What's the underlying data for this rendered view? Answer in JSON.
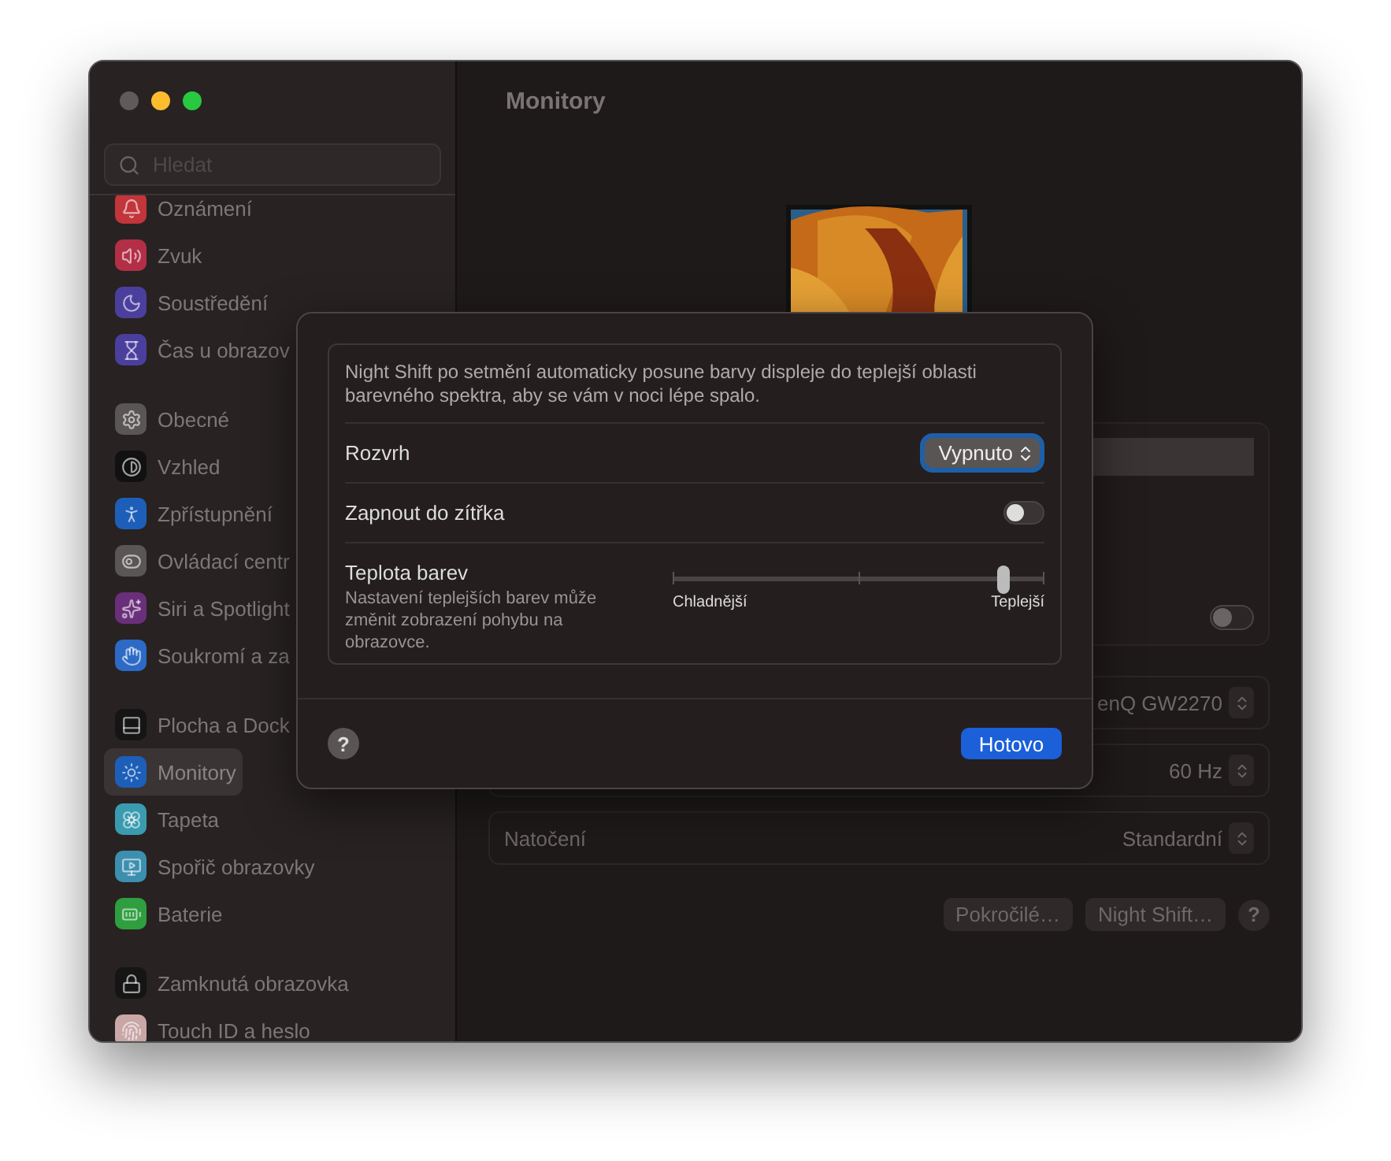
{
  "window": {
    "controls": [
      {
        "color": "#5f5b5b"
      },
      {
        "color": "#febc2e"
      },
      {
        "color": "#28c840"
      }
    ]
  },
  "sidebar": {
    "search": {
      "placeholder": "Hledat"
    },
    "groups": [
      {
        "items": [
          {
            "label": "Oznámení",
            "color": "#c2353b",
            "selected": false
          },
          {
            "label": "Zvuk",
            "color": "#b22f46",
            "selected": false
          },
          {
            "label": "Soustředění",
            "color": "#4b3f9e",
            "selected": false
          },
          {
            "label": "Čas u obrazov",
            "color": "#4b3f9e",
            "selected": false
          }
        ]
      },
      {
        "items": [
          {
            "label": "Obecné",
            "color": "#5a5656",
            "selected": false
          },
          {
            "label": "Vzhled",
            "color": "#111111",
            "selected": false
          },
          {
            "label": "Zpřístupnění",
            "color": "#1d5fb8",
            "selected": false
          },
          {
            "label": "Ovládací centr",
            "color": "#5a5656",
            "selected": false
          },
          {
            "label": "Siri a Spotlight",
            "color": "#6a2f7a",
            "selected": false
          },
          {
            "label": "Soukromí a za",
            "color": "#2c6ac6",
            "selected": false
          }
        ]
      },
      {
        "items": [
          {
            "label": "Plocha a Dock",
            "color": "#151515",
            "selected": false
          },
          {
            "label": "Monitory",
            "color": "#1d5fb8",
            "selected": true
          },
          {
            "label": "Tapeta",
            "color": "#3a9bb0",
            "selected": false
          },
          {
            "label": "Spořič obrazovky",
            "color": "#3d8fb0",
            "selected": false
          },
          {
            "label": "Baterie",
            "color": "#2f9e3f",
            "selected": false
          }
        ]
      },
      {
        "items": [
          {
            "label": "Zamknutá obrazovka",
            "color": "#151515",
            "selected": false
          },
          {
            "label": "Touch ID a heslo",
            "color": "#c9a7a7",
            "selected": false
          }
        ]
      }
    ]
  },
  "main": {
    "title": "Monitory",
    "display_toggle": {
      "on": false
    },
    "rows": [
      {
        "label": "",
        "value": "enQ GW2270"
      },
      {
        "label": "",
        "value": "60 Hz"
      },
      {
        "label": "Natočení",
        "value": "Standardní"
      }
    ],
    "buttons": [
      "Pokročilé…",
      "Night Shift…"
    ]
  },
  "sheet": {
    "description": "Night Shift po setmění automaticky posune barvy displeje do teplejší oblasti barevného spektra, aby se vám v noci lépe spalo.",
    "schedule": {
      "label": "Rozvrh",
      "value": "Vypnuto"
    },
    "until_tomorrow": {
      "label": "Zapnout do zítřka",
      "on": false
    },
    "temperature": {
      "label": "Teplota barev",
      "note": "Nastavení teplejších barev může změnit zobrazení pohybu na obrazovce.",
      "level": 0.89,
      "min_label": "Chladnější",
      "max_label": "Teplejší"
    },
    "help": "?",
    "done": "Hotovo"
  }
}
